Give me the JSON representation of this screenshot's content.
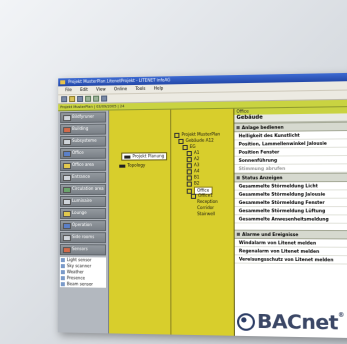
{
  "window": {
    "title": "Projekt MusterPlan.LitenetProjekt - LITENET infoAG"
  },
  "menu": [
    "File",
    "Edit",
    "View",
    "Online",
    "Tools",
    "Help"
  ],
  "infobar": {
    "text": "Projekt MusterPlan | 03/09/2005 | 24"
  },
  "nav": {
    "items": [
      {
        "label": "Bildfyruner",
        "color": "#cfd4da"
      },
      {
        "label": "Building",
        "color": "#d26a4a"
      },
      {
        "label": "Subsysteme",
        "color": "#cfd4da"
      },
      {
        "label": "Office",
        "color": "#5b80c8"
      },
      {
        "label": "Office area",
        "color": "#e2c94e"
      },
      {
        "label": "Entrance",
        "color": "#cfd4da"
      },
      {
        "label": "Circulation area",
        "color": "#6ba56b"
      },
      {
        "label": "Luminaire",
        "color": "#cfd4da"
      },
      {
        "label": "Lounge",
        "color": "#e2c94e"
      },
      {
        "label": "Operation",
        "color": "#5b80c8"
      },
      {
        "label": "Side rooms",
        "color": "#cfd4da"
      },
      {
        "label": "Sensors",
        "color": "#d26a4a"
      }
    ],
    "list": [
      "Light sensor",
      "Sky scanner",
      "Weather",
      "Presence",
      "Beam sensor"
    ]
  },
  "panel1": {
    "selected": "Projekt Planung",
    "topology": "Topology"
  },
  "tree": {
    "root": "Projekt MusterPlan",
    "building": "Gebäude A12",
    "floor": "EG",
    "nodes": [
      "A1",
      "A2",
      "A3",
      "A4",
      "B1",
      "B2"
    ],
    "selected": "Office",
    "office1": "Office1",
    "leaves": [
      "Reception",
      "Corridor",
      "Stairwell"
    ]
  },
  "detail": {
    "crumb": "Office",
    "heading": "Gebäude",
    "section1": "Anlage bedienen",
    "rows1": [
      "Helligkeit des Kunstlicht",
      "Position, Lammellenwinkel Jalousie",
      "Position Fenster",
      "Sonnenführung",
      "Stimmung abrufen"
    ],
    "section2": "Status Anzeigen",
    "rows2": [
      "Gesammelte Störmeldung Licht",
      "Gesammelte Störmeldung Jalousie",
      "Gesammelte Störmeldung Fenster",
      "Gesammelte Störmeldung Lüftung",
      "Gesammelte Anwesenheitsmeldung"
    ],
    "section3": "Alarme und Ereignisse",
    "rows3": [
      "Windalarm von Litenet melden",
      "Regenalarm von Litenet melden",
      "Vereisungsschutz von Litenet melden"
    ]
  },
  "logo": {
    "text": "BACnet",
    "mark": "®"
  }
}
